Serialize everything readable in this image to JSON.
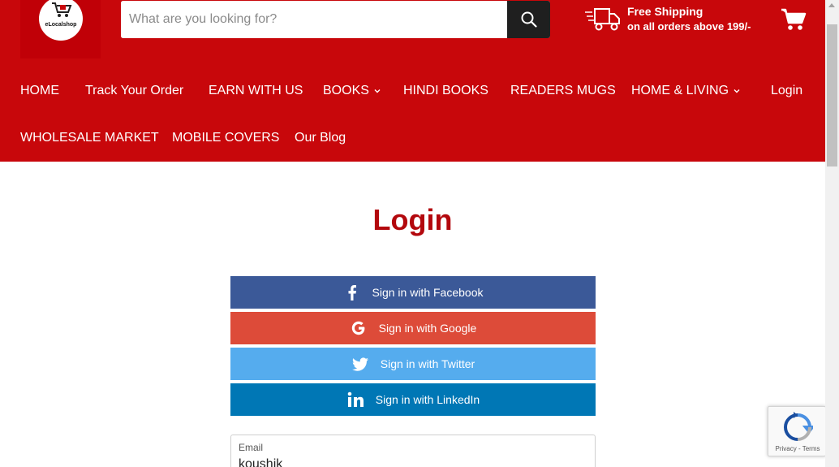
{
  "header": {
    "logo_text": "eLocalshop",
    "search_placeholder": "What are you looking for?",
    "shipping_title": "Free Shipping",
    "shipping_subtitle": "on all orders above 199/-"
  },
  "nav": {
    "row1": [
      "HOME",
      "Track Your Order",
      "EARN WITH US",
      "BOOKS",
      "HINDI BOOKS",
      "READERS MUGS",
      "HOME & LIVING",
      "Login"
    ],
    "row2": [
      "WHOLESALE MARKET",
      "MOBILE COVERS",
      "Our Blog"
    ]
  },
  "main": {
    "title": "Login",
    "facebook_label": "Sign in with Facebook",
    "google_label": "Sign in with Google",
    "twitter_label": "Sign in with Twitter",
    "linkedin_label": "Sign in with LinkedIn",
    "email_label": "Email",
    "email_value": "koushik"
  },
  "recaptcha": {
    "links": "Privacy - Terms"
  },
  "colors": {
    "brand_red": "#c8070b",
    "title_red": "#b3080d",
    "facebook": "#3b5998",
    "google": "#dd4b39",
    "twitter": "#55acee",
    "linkedin": "#0077b5"
  },
  "icons": [
    "cart-logo-icon",
    "search-icon",
    "delivery-truck-icon",
    "shopping-cart-icon",
    "chevron-down-icon",
    "facebook-icon",
    "google-icon",
    "twitter-icon",
    "linkedin-icon",
    "recaptcha-icon"
  ]
}
